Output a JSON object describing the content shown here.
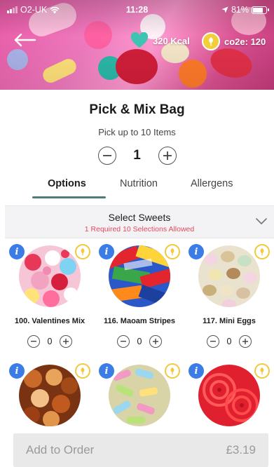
{
  "status_bar": {
    "carrier": "O2-UK",
    "time": "11:28",
    "battery": "81%",
    "battery_level": 0.81
  },
  "hero": {
    "kcal": "320 Kcal",
    "co2": "co2e: 120"
  },
  "product": {
    "title": "Pick & Mix Bag",
    "subtitle": "Pick up to 10 Items",
    "quantity": "1"
  },
  "tabs": [
    {
      "label": "Options",
      "active": true
    },
    {
      "label": "Nutrition",
      "active": false
    },
    {
      "label": "Allergens",
      "active": false
    }
  ],
  "section": {
    "title": "Select Sweets",
    "requirement": "1 Required 10 Selections Allowed"
  },
  "items": [
    {
      "name": "100. Valentines Mix",
      "qty": "0"
    },
    {
      "name": "116. Maoam Stripes",
      "qty": "0"
    },
    {
      "name": "117. Mini Eggs",
      "qty": "0"
    },
    {
      "name": "",
      "qty": ""
    },
    {
      "name": "",
      "qty": ""
    },
    {
      "name": "",
      "qty": ""
    }
  ],
  "order": {
    "label": "Add to Order",
    "price": "£3.19"
  },
  "colors": {
    "accent": "#4f7c7a",
    "info": "#3c7ce6",
    "eco": "#f1c93a",
    "required": "#e24a5c"
  }
}
